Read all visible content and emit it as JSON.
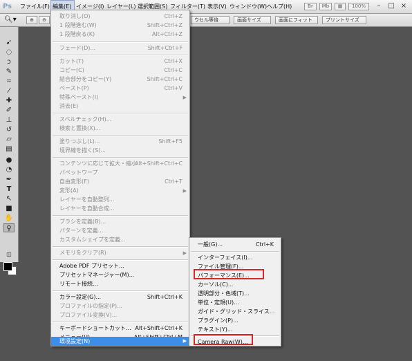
{
  "app": {
    "logo": "Ps"
  },
  "menubar": {
    "items": [
      "ファイル(F)",
      "編集(E)",
      "イメージ(I)",
      "レイヤー(L)",
      "選択範囲(S)",
      "フィルター(T)",
      "表示(V)",
      "ウィンドウ(W)",
      "ヘルプ(H)"
    ],
    "zoom": "100%",
    "window_controls": [
      "–",
      "□",
      "×"
    ]
  },
  "options_bar": {
    "buttons": [
      "ウセル等倍",
      "画面サイズ",
      "画面にフィット",
      "プリントサイズ"
    ]
  },
  "tools": {
    "icons": [
      "move-tool",
      "marquee-tool",
      "lasso-tool",
      "quick-select-tool",
      "crop-tool",
      "eyedropper-tool",
      "healing-brush-tool",
      "brush-tool",
      "clone-stamp-tool",
      "history-brush-tool",
      "eraser-tool",
      "gradient-tool",
      "blur-tool",
      "dodge-tool",
      "pen-tool",
      "type-tool",
      "path-select-tool",
      "shape-tool",
      "hand-tool",
      "zoom-tool"
    ]
  },
  "edit_menu": {
    "items": [
      {
        "label": "取り消し(O)",
        "shortcut": "Ctrl+Z",
        "state": "disabled"
      },
      {
        "label": "1 段階進む(W)",
        "shortcut": "Shift+Ctrl+Z",
        "state": "disabled"
      },
      {
        "label": "1 段階戻る(K)",
        "shortcut": "Alt+Ctrl+Z",
        "state": "disabled"
      },
      {
        "separator": true
      },
      {
        "label": "フェード(D)...",
        "shortcut": "Shift+Ctrl+F",
        "state": "disabled"
      },
      {
        "separator": true
      },
      {
        "label": "カット(T)",
        "shortcut": "Ctrl+X",
        "state": "disabled"
      },
      {
        "label": "コピー(C)",
        "shortcut": "Ctrl+C",
        "state": "disabled"
      },
      {
        "label": "結合部分をコピー(Y)",
        "shortcut": "Shift+Ctrl+C",
        "state": "disabled"
      },
      {
        "label": "ペースト(P)",
        "shortcut": "Ctrl+V",
        "state": "disabled"
      },
      {
        "label": "特殊ペースト(I)",
        "shortcut": "",
        "state": "disabled",
        "submenu": true
      },
      {
        "label": "消去(E)",
        "shortcut": "",
        "state": "disabled"
      },
      {
        "separator": true
      },
      {
        "label": "スペルチェック(H)...",
        "shortcut": "",
        "state": "disabled"
      },
      {
        "label": "検索と置換(X)...",
        "shortcut": "",
        "state": "disabled"
      },
      {
        "separator": true
      },
      {
        "label": "塗りつぶし(L)...",
        "shortcut": "Shift+F5",
        "state": "disabled"
      },
      {
        "label": "境界線を描く(S)...",
        "shortcut": "",
        "state": "disabled"
      },
      {
        "separator": true
      },
      {
        "label": "コンテンツに応じて拡大・縮小",
        "shortcut": "Alt+Shift+Ctrl+C",
        "state": "disabled"
      },
      {
        "label": "パペットワープ",
        "shortcut": "",
        "state": "disabled"
      },
      {
        "label": "自由変形(F)",
        "shortcut": "Ctrl+T",
        "state": "disabled"
      },
      {
        "label": "変形(A)",
        "shortcut": "",
        "state": "disabled",
        "submenu": true
      },
      {
        "label": "レイヤーを自動整列...",
        "shortcut": "",
        "state": "disabled"
      },
      {
        "label": "レイヤーを自動合成...",
        "shortcut": "",
        "state": "disabled"
      },
      {
        "separator": true
      },
      {
        "label": "ブラシを定義(B)...",
        "shortcut": "",
        "state": "disabled"
      },
      {
        "label": "パターンを定義...",
        "shortcut": "",
        "state": "disabled"
      },
      {
        "label": "カスタムシェイプを定義...",
        "shortcut": "",
        "state": "disabled"
      },
      {
        "separator": true
      },
      {
        "label": "メモリをクリア(R)",
        "shortcut": "",
        "state": "disabled",
        "submenu": true
      },
      {
        "separator": true
      },
      {
        "label": "Adobe PDF プリセット...",
        "shortcut": "",
        "state": "enabled"
      },
      {
        "label": "プリセットマネージャー(M)...",
        "shortcut": "",
        "state": "enabled"
      },
      {
        "label": "リモート接続...",
        "shortcut": "",
        "state": "enabled"
      },
      {
        "separator": true
      },
      {
        "label": "カラー設定(G)...",
        "shortcut": "Shift+Ctrl+K",
        "state": "enabled"
      },
      {
        "label": "プロファイルの指定(P)...",
        "shortcut": "",
        "state": "disabled"
      },
      {
        "label": "プロファイル変換(V)...",
        "shortcut": "",
        "state": "disabled"
      },
      {
        "separator": true
      },
      {
        "label": "キーボードショートカット...",
        "shortcut": "Alt+Shift+Ctrl+K",
        "state": "enabled"
      },
      {
        "label": "メニュー(U)...",
        "shortcut": "Alt+Shift+Ctrl+M",
        "state": "enabled"
      },
      {
        "label": "環境設定(N)",
        "shortcut": "",
        "state": "highlighted",
        "submenu": true
      }
    ]
  },
  "preferences_submenu": {
    "items": [
      {
        "label": "一般(G)...",
        "shortcut": "Ctrl+K"
      },
      {
        "separator": true
      },
      {
        "label": "インターフェイス(I)..."
      },
      {
        "label": "ファイル管理(F)..."
      },
      {
        "label": "パフォーマンス(E)...",
        "boxed": true
      },
      {
        "label": "カーソル(C)..."
      },
      {
        "label": "透明部分・色域(T)..."
      },
      {
        "label": "単位・定規(U)..."
      },
      {
        "label": "ガイド・グリッド・スライス..."
      },
      {
        "label": "プラグイン(P)..."
      },
      {
        "label": "テキスト(Y)..."
      },
      {
        "separator": true
      },
      {
        "label": "Camera Raw(W)...",
        "boxed": true
      }
    ]
  },
  "colors": {
    "highlight": "#3d8ee8",
    "callout_box": "#d8262b"
  }
}
